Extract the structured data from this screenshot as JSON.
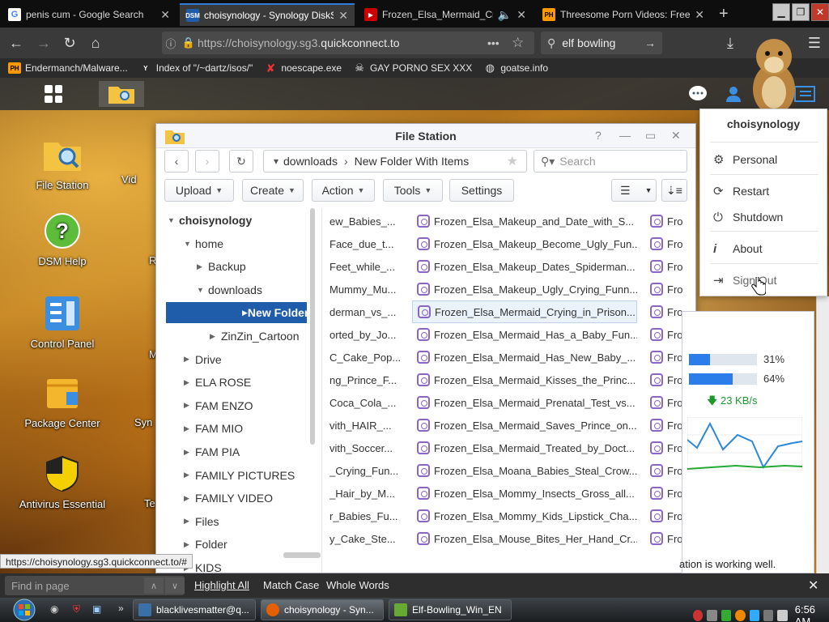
{
  "browser": {
    "tabs": [
      {
        "title": "penis cum - Google Search",
        "favicon": "google-icon"
      },
      {
        "title": "choisynology - Synology DiskS",
        "favicon": "dsm-icon"
      },
      {
        "title": "Frozen_Elsa_Mermaid_Crying",
        "favicon": "youtube-icon"
      },
      {
        "title": "Threesome Porn Videos: Free",
        "favicon": "ph-icon"
      }
    ],
    "url_prefix": "https://choisynology.sg3.",
    "url_domain": "quickconnect.to",
    "url_more": "•••",
    "search_value": "elf bowling",
    "bookmarks": [
      {
        "label": "Endermanch/Malware...",
        "icon": "PH"
      },
      {
        "label": "Index of \"/~dartz/isos/\"",
        "icon": "Y"
      },
      {
        "label": "noescape.exe",
        "icon": "X"
      },
      {
        "label": "GAY PORNO SEX XXX",
        "icon": "skull"
      },
      {
        "label": "goatse.info",
        "icon": "globe"
      }
    ]
  },
  "desktop": {
    "icons": [
      {
        "label": "File Station"
      },
      {
        "label": "DSM Help"
      },
      {
        "label": "Control Panel"
      },
      {
        "label": "Package Center"
      },
      {
        "label": "Antivirus Essential"
      }
    ],
    "partial_labels": [
      "Vid",
      "R",
      "M",
      "Syn",
      "Te"
    ]
  },
  "filestation": {
    "title": "File Station",
    "path_prev": "downloads",
    "path_current": "New Folder With Items",
    "search_placeholder": "Search",
    "toolbar": {
      "upload": "Upload",
      "create": "Create",
      "action": "Action",
      "tools": "Tools",
      "settings": "Settings"
    },
    "tree": [
      {
        "label": "choisynology",
        "level": 0,
        "arrow": "down",
        "bold": true
      },
      {
        "label": "home",
        "level": 1,
        "arrow": "down"
      },
      {
        "label": "Backup",
        "level": 2,
        "arrow": "right"
      },
      {
        "label": "downloads",
        "level": 2,
        "arrow": "down"
      },
      {
        "label": "New Folder With",
        "level": 3,
        "arrow": "right",
        "selected": true
      },
      {
        "label": "ZinZin_Cartoon",
        "level": 3,
        "arrow": "right"
      },
      {
        "label": "Drive",
        "level": 1,
        "arrow": "right"
      },
      {
        "label": "ELA ROSE",
        "level": 1,
        "arrow": "right"
      },
      {
        "label": "FAM ENZO",
        "level": 1,
        "arrow": "right"
      },
      {
        "label": "FAM MIO",
        "level": 1,
        "arrow": "right"
      },
      {
        "label": "FAM PIA",
        "level": 1,
        "arrow": "right"
      },
      {
        "label": "FAMILY PICTURES",
        "level": 1,
        "arrow": "right"
      },
      {
        "label": "FAMILY VIDEO",
        "level": 1,
        "arrow": "right"
      },
      {
        "label": "Files",
        "level": 1,
        "arrow": "right"
      },
      {
        "label": "Folder",
        "level": 1,
        "arrow": "right"
      },
      {
        "label": "KIDS",
        "level": 1,
        "arrow": "right"
      }
    ],
    "files": [
      {
        "col1": "ew_Babies_...",
        "col2": "Frozen_Elsa_Makeup_and_Date_with_S...",
        "col3": "Fro"
      },
      {
        "col1": "Face_due_t...",
        "col2": "Frozen_Elsa_Makeup_Become_Ugly_Fun...",
        "col3": "Fro"
      },
      {
        "col1": "Feet_while_...",
        "col2": "Frozen_Elsa_Makeup_Dates_Spiderman...",
        "col3": "Fro"
      },
      {
        "col1": "Mummy_Mu...",
        "col2": "Frozen_Elsa_Makeup_Ugly_Crying_Funn...",
        "col3": "Fro"
      },
      {
        "col1": "derman_vs_...",
        "col2": "Frozen_Elsa_Mermaid_Crying_in_Prison...",
        "col3": "Fro",
        "selected": true
      },
      {
        "col1": "orted_by_Jo...",
        "col2": "Frozen_Elsa_Mermaid_Has_a_Baby_Fun...",
        "col3": "Fro"
      },
      {
        "col1": "C_Cake_Pop...",
        "col2": "Frozen_Elsa_Mermaid_Has_New_Baby_...",
        "col3": "Fro"
      },
      {
        "col1": "ng_Prince_F...",
        "col2": "Frozen_Elsa_Mermaid_Kisses_the_Princ...",
        "col3": "Fro"
      },
      {
        "col1": "Coca_Cola_...",
        "col2": "Frozen_Elsa_Mermaid_Prenatal_Test_vs...",
        "col3": "Fro"
      },
      {
        "col1": "vith_HAIR_...",
        "col2": "Frozen_Elsa_Mermaid_Saves_Prince_on...",
        "col3": "Fro"
      },
      {
        "col1": "vith_Soccer...",
        "col2": "Frozen_Elsa_Mermaid_Treated_by_Doct...",
        "col3": "Fro"
      },
      {
        "col1": "_Crying_Fun...",
        "col2": "Frozen_Elsa_Moana_Babies_Steal_Crow...",
        "col3": "Fro"
      },
      {
        "col1": "_Hair_by_M...",
        "col2": "Frozen_Elsa_Mommy_Insects_Gross_all...",
        "col3": "Fro"
      },
      {
        "col1": "r_Babies_Fu...",
        "col2": "Frozen_Elsa_Mommy_Kids_Lipstick_Cha...",
        "col3": "Fro"
      },
      {
        "col1": "y_Cake_Ste...",
        "col2": "Frozen_Elsa_Mouse_Bites_Her_Hand_Cr...",
        "col3": "Fro"
      }
    ]
  },
  "usermenu": {
    "username": "choisynology",
    "items": [
      {
        "label": "Personal",
        "icon": "gear-icon"
      },
      {
        "label": "Restart",
        "icon": "restart-icon"
      },
      {
        "label": "Shutdown",
        "icon": "power-icon"
      },
      {
        "label": "About",
        "icon": "info-icon"
      },
      {
        "label": "Sign Out",
        "icon": "sign-out-icon"
      }
    ]
  },
  "widget": {
    "progress": [
      {
        "fraction": 0.31,
        "label": "31%"
      },
      {
        "fraction": 0.64,
        "label": "64%"
      }
    ],
    "speed": "23 KB/s",
    "footer_text": "ation is working well."
  },
  "statusbar": {
    "url": "https://choisynology.sg3.quickconnect.to/#"
  },
  "findbar": {
    "placeholder": "Find in page",
    "highlight_all": "Highlight All",
    "match_case": "Match Case",
    "whole_words": "Whole Words"
  },
  "taskbar": {
    "tasks": [
      {
        "label": "blacklivesmatter@q..."
      },
      {
        "label": "choisynology - Syn..."
      },
      {
        "label": "Elf-Bowling_Win_EN"
      }
    ],
    "time": "6:56 AM"
  },
  "colors": {
    "accent": "#1f5dab",
    "tab_accent": "#2f7bd8",
    "progress": "#2b7de9",
    "speed_green": "#1a9a2a"
  }
}
